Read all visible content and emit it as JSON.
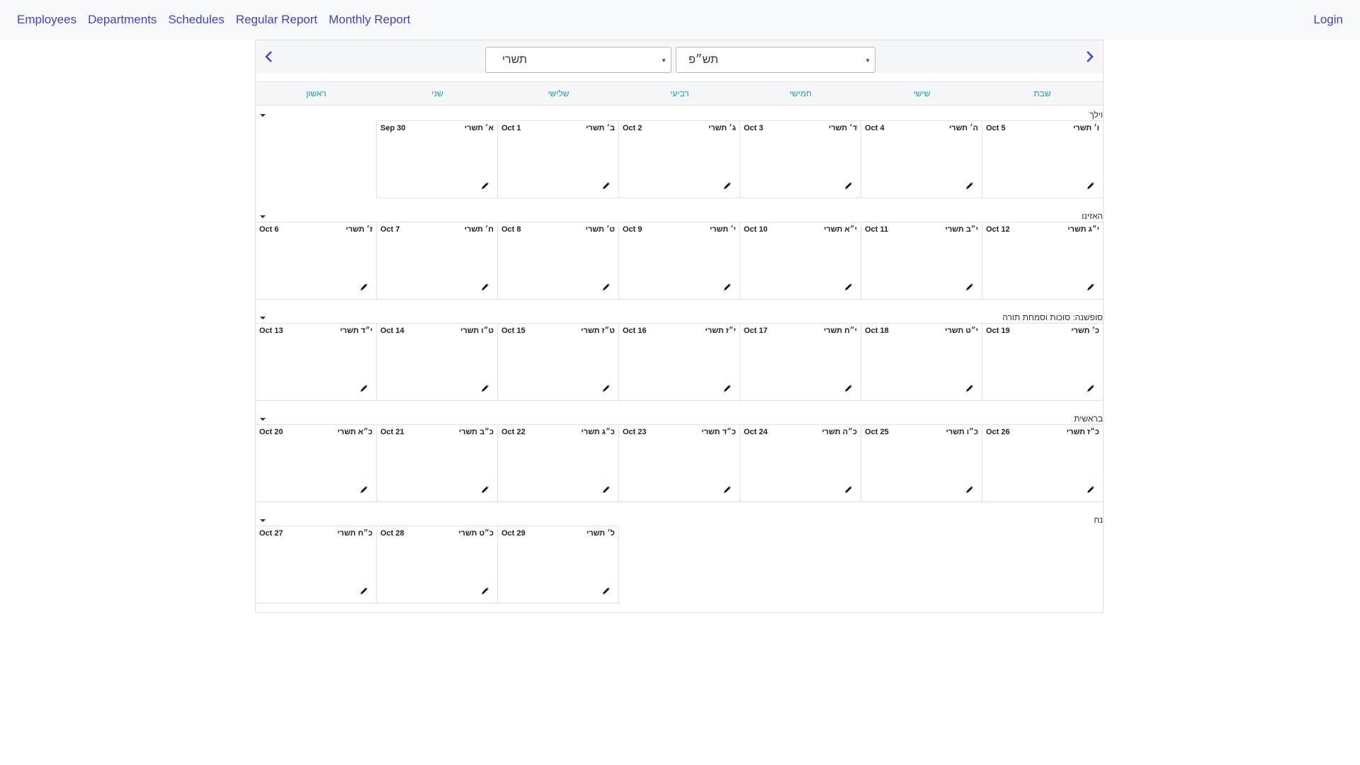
{
  "nav": {
    "links": [
      "Employees",
      "Departments",
      "Schedules",
      "Regular Report",
      "Monthly Report"
    ],
    "login": "Login"
  },
  "calendar": {
    "month_select": "תשרי",
    "year_select": "תש״פ",
    "day_names": [
      "ראשון",
      "שני",
      "שלישי",
      "רביעי",
      "חמישי",
      "שישי",
      "שבת"
    ],
    "weeks": [
      {
        "label": "וילך",
        "days": [
          {
            "col": 1,
            "greg": "Sep 30",
            "heb": "א׳ תשרי"
          },
          {
            "col": 2,
            "greg": "Oct 1",
            "heb": "ב׳ תשרי"
          },
          {
            "col": 3,
            "greg": "Oct 2",
            "heb": "ג׳ תשרי"
          },
          {
            "col": 4,
            "greg": "Oct 3",
            "heb": "ד׳ תשרי"
          },
          {
            "col": 5,
            "greg": "Oct 4",
            "heb": "ה׳ תשרי"
          },
          {
            "col": 6,
            "greg": "Oct 5",
            "heb": "ו׳ תשרי"
          }
        ]
      },
      {
        "label": "האזינו",
        "days": [
          {
            "col": 0,
            "greg": "Oct 6",
            "heb": "ז׳ תשרי"
          },
          {
            "col": 1,
            "greg": "Oct 7",
            "heb": "ח׳ תשרי"
          },
          {
            "col": 2,
            "greg": "Oct 8",
            "heb": "ט׳ תשרי"
          },
          {
            "col": 3,
            "greg": "Oct 9",
            "heb": "י׳ תשרי"
          },
          {
            "col": 4,
            "greg": "Oct 10",
            "heb": "י״א תשרי"
          },
          {
            "col": 5,
            "greg": "Oct 11",
            "heb": "י״ב תשרי"
          },
          {
            "col": 6,
            "greg": "Oct 12",
            "heb": "י״ג תשרי"
          }
        ]
      },
      {
        "label": "סופשנה: סוכות וסמחת תורה",
        "days": [
          {
            "col": 0,
            "greg": "Oct 13",
            "heb": "י״ד תשרי"
          },
          {
            "col": 1,
            "greg": "Oct 14",
            "heb": "ט״ו תשרי"
          },
          {
            "col": 2,
            "greg": "Oct 15",
            "heb": "ט״ז תשרי"
          },
          {
            "col": 3,
            "greg": "Oct 16",
            "heb": "י״ז תשרי"
          },
          {
            "col": 4,
            "greg": "Oct 17",
            "heb": "י״ח תשרי"
          },
          {
            "col": 5,
            "greg": "Oct 18",
            "heb": "י״ט תשרי"
          },
          {
            "col": 6,
            "greg": "Oct 19",
            "heb": "כ׳ תשרי"
          }
        ]
      },
      {
        "label": "בראשית",
        "days": [
          {
            "col": 0,
            "greg": "Oct 20",
            "heb": "כ״א תשרי"
          },
          {
            "col": 1,
            "greg": "Oct 21",
            "heb": "כ״ב תשרי"
          },
          {
            "col": 2,
            "greg": "Oct 22",
            "heb": "כ״ג תשרי"
          },
          {
            "col": 3,
            "greg": "Oct 23",
            "heb": "כ״ד תשרי"
          },
          {
            "col": 4,
            "greg": "Oct 24",
            "heb": "כ״ה תשרי"
          },
          {
            "col": 5,
            "greg": "Oct 25",
            "heb": "כ״ו תשרי"
          },
          {
            "col": 6,
            "greg": "Oct 26",
            "heb": "כ״ז תשרי"
          }
        ]
      },
      {
        "label": "נח",
        "days": [
          {
            "col": 0,
            "greg": "Oct 27",
            "heb": "כ״ח תשרי"
          },
          {
            "col": 1,
            "greg": "Oct 28",
            "heb": "כ״ט תשרי"
          },
          {
            "col": 2,
            "greg": "Oct 29",
            "heb": "ל׳ תשרי"
          }
        ]
      }
    ]
  },
  "icons": {
    "prev": "chevron-left-icon",
    "next": "chevron-right-icon",
    "edit": "pencil-icon",
    "toggle": "caret-down-icon",
    "select": "select-caret-icon"
  },
  "colors": {
    "link": "#3f3fd8",
    "dayname": "#17a2b8",
    "header_bg": "#f6f7f8",
    "border": "#dee2e6"
  }
}
